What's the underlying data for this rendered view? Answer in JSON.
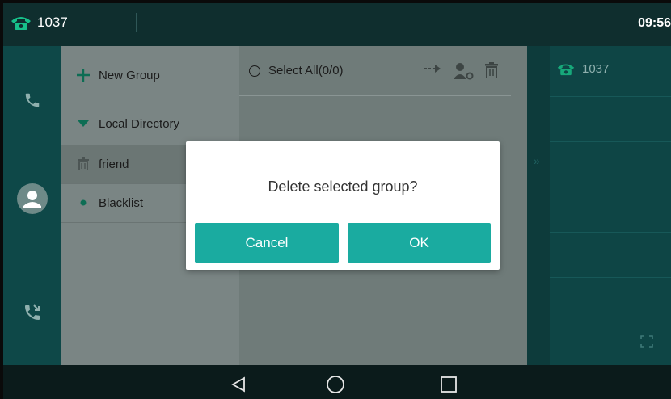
{
  "status": {
    "line_number": "1037",
    "time": "09:56"
  },
  "sidebar": {
    "new_group_label": "New Group",
    "items": [
      {
        "label": "Local Directory"
      },
      {
        "label": "friend"
      },
      {
        "label": "Blacklist"
      }
    ]
  },
  "content": {
    "select_all_label": "Select All(0/0)"
  },
  "right_pane": {
    "line_label": "1037"
  },
  "dialog": {
    "message": "Delete selected group?",
    "cancel_label": "Cancel",
    "ok_label": "OK"
  },
  "colors": {
    "accent": "#1aaba0",
    "status_icon": "#17c08a"
  }
}
